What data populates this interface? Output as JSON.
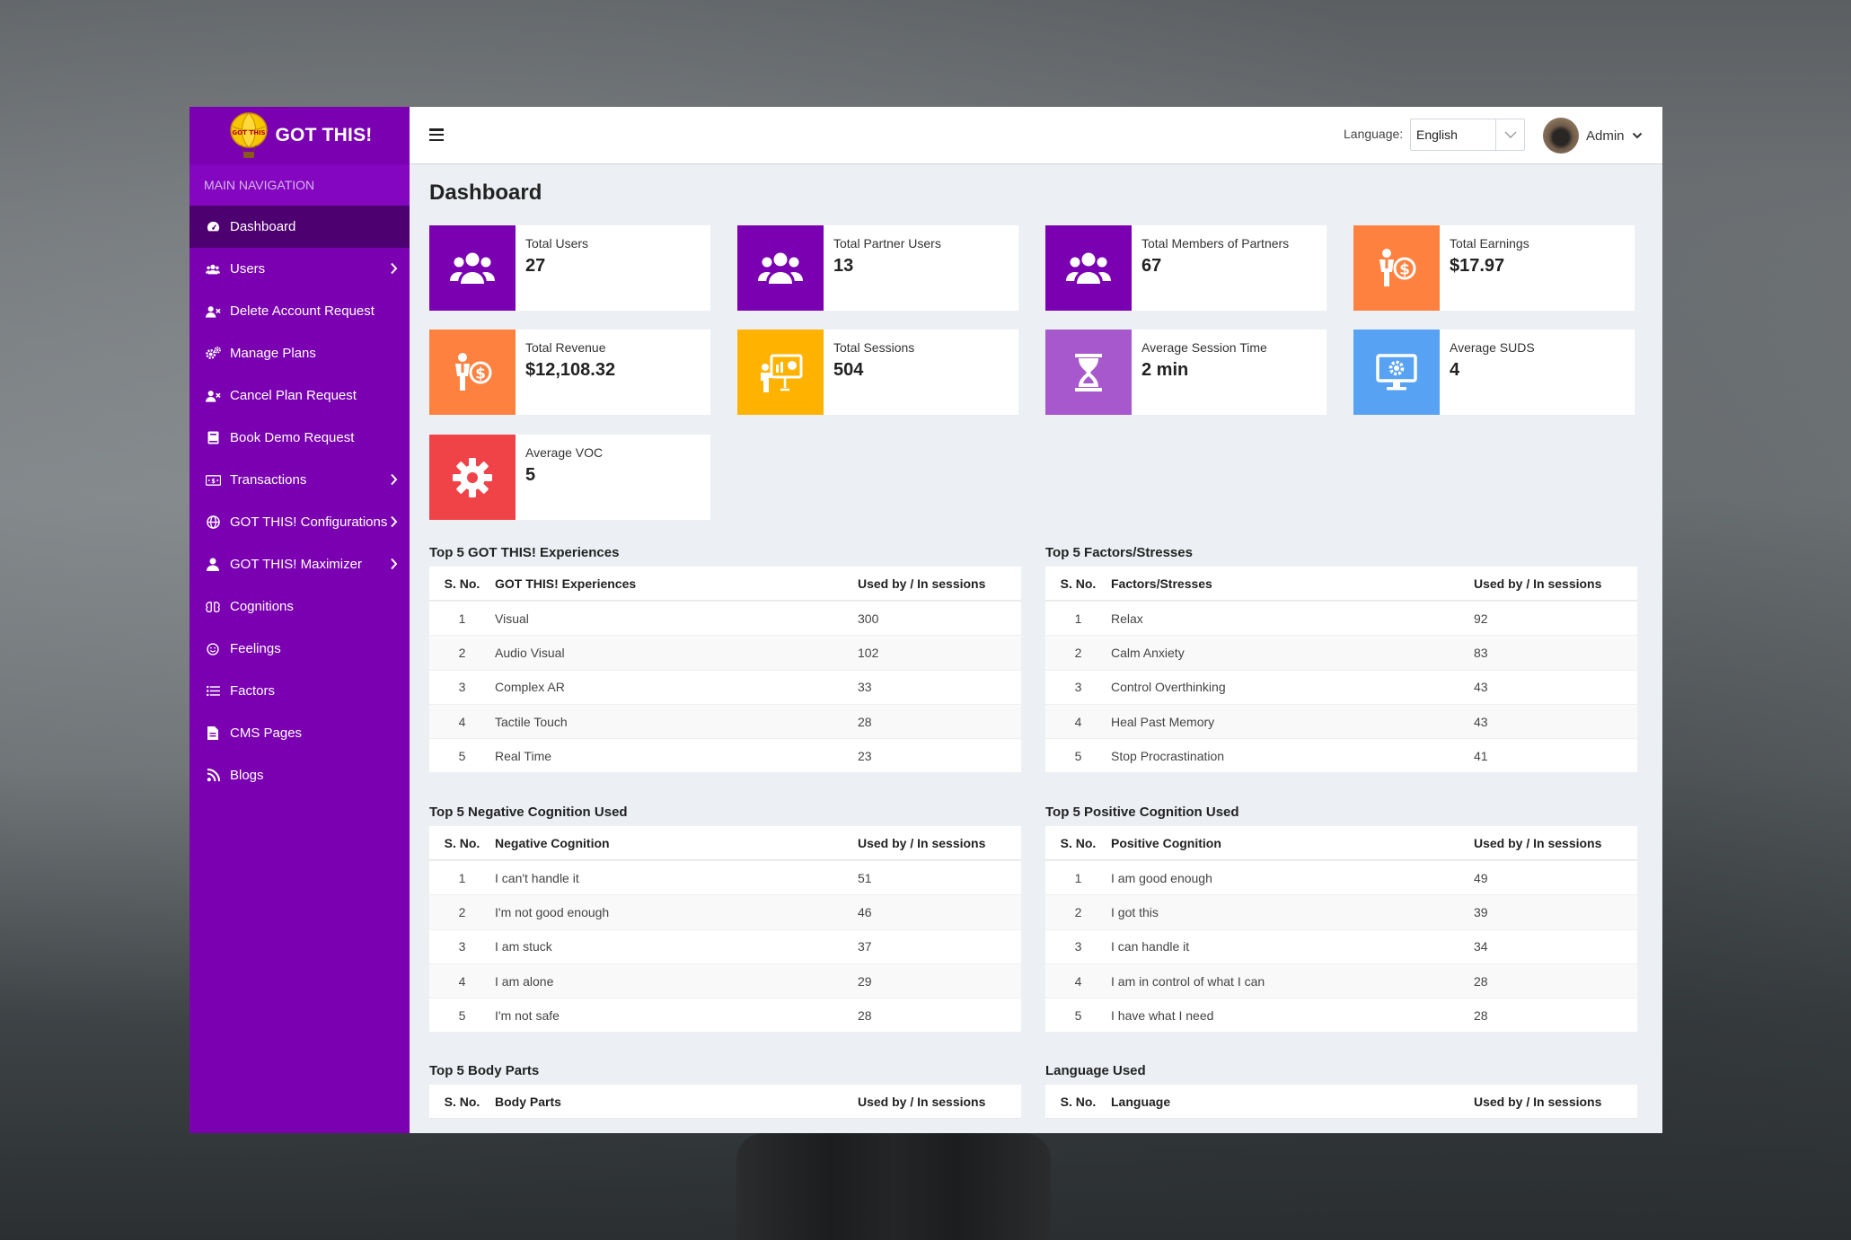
{
  "brand": {
    "name": "GOT THIS!"
  },
  "sidebar": {
    "header": "MAIN NAVIGATION",
    "items": [
      {
        "label": "Dashboard",
        "icon": "dashboard-icon",
        "active": true,
        "chevron": false
      },
      {
        "label": "Users",
        "icon": "users-icon",
        "active": false,
        "chevron": true
      },
      {
        "label": "Delete Account Request",
        "icon": "user-x-icon",
        "active": false,
        "chevron": false
      },
      {
        "label": "Manage Plans",
        "icon": "gears-icon",
        "active": false,
        "chevron": false
      },
      {
        "label": "Cancel Plan Request",
        "icon": "user-x-icon",
        "active": false,
        "chevron": false
      },
      {
        "label": "Book Demo Request",
        "icon": "book-icon",
        "active": false,
        "chevron": false
      },
      {
        "label": "Transactions",
        "icon": "money-icon",
        "active": false,
        "chevron": true
      },
      {
        "label": "GOT THIS! Configurations",
        "icon": "globe-icon",
        "active": false,
        "chevron": true
      },
      {
        "label": "GOT THIS! Maximizer",
        "icon": "user-icon",
        "active": false,
        "chevron": true
      },
      {
        "label": "Cognitions",
        "icon": "brain-icon",
        "active": false,
        "chevron": false
      },
      {
        "label": "Feelings",
        "icon": "smile-icon",
        "active": false,
        "chevron": false
      },
      {
        "label": "Factors",
        "icon": "list-icon",
        "active": false,
        "chevron": false
      },
      {
        "label": "CMS Pages",
        "icon": "file-icon",
        "active": false,
        "chevron": false
      },
      {
        "label": "Blogs",
        "icon": "blog-icon",
        "active": false,
        "chevron": false
      }
    ]
  },
  "header": {
    "language_label": "Language:",
    "language_value": "English",
    "user_name": "Admin"
  },
  "page": {
    "title": "Dashboard"
  },
  "colors": {
    "sidebar": "#7a00b2",
    "purple": "#7a00b2",
    "orange": "#ff8140",
    "yellow": "#ffb300",
    "lavender": "#a758cc",
    "blue": "#57a2f2",
    "red": "#f04348"
  },
  "stats": [
    {
      "label": "Total Users",
      "value": "27",
      "icon": "users-group-icon",
      "color": "#7a00b2"
    },
    {
      "label": "Total Partner Users",
      "value": "13",
      "icon": "users-group-icon",
      "color": "#7a00b2"
    },
    {
      "label": "Total Members of Partners",
      "value": "67",
      "icon": "users-group-icon",
      "color": "#7a00b2"
    },
    {
      "label": "Total Earnings",
      "value": "$17.97",
      "icon": "earnings-icon",
      "color": "#ff8140"
    },
    {
      "label": "Total Revenue",
      "value": "$12,108.32",
      "icon": "earnings-icon",
      "color": "#ff8140"
    },
    {
      "label": "Total Sessions",
      "value": "504",
      "icon": "presentation-icon",
      "color": "#ffb300"
    },
    {
      "label": "Average Session Time",
      "value": "2 min",
      "icon": "hourglass-icon",
      "color": "#a758cc"
    },
    {
      "label": "Average SUDS",
      "value": "4",
      "icon": "monitor-gear-icon",
      "color": "#57a2f2"
    },
    {
      "label": "Average VOC",
      "value": "5",
      "icon": "gear-icon",
      "color": "#f04348"
    }
  ],
  "tables": [
    {
      "title": "Top 5 GOT THIS! Experiences",
      "columns": [
        "S. No.",
        "GOT THIS! Experiences",
        "Used by / In sessions"
      ],
      "rows": [
        [
          "1",
          "Visual",
          "300"
        ],
        [
          "2",
          "Audio Visual",
          "102"
        ],
        [
          "3",
          "Complex AR",
          "33"
        ],
        [
          "4",
          "Tactile Touch",
          "28"
        ],
        [
          "5",
          "Real Time",
          "23"
        ]
      ]
    },
    {
      "title": "Top 5 Factors/Stresses",
      "columns": [
        "S. No.",
        "Factors/Stresses",
        "Used by / In sessions"
      ],
      "rows": [
        [
          "1",
          "Relax",
          "92"
        ],
        [
          "2",
          "Calm Anxiety",
          "83"
        ],
        [
          "3",
          "Control Overthinking",
          "43"
        ],
        [
          "4",
          "Heal Past Memory",
          "43"
        ],
        [
          "5",
          "Stop Procrastination",
          "41"
        ]
      ]
    },
    {
      "title": "Top 5 Negative Cognition Used",
      "columns": [
        "S. No.",
        "Negative Cognition",
        "Used by / In sessions"
      ],
      "rows": [
        [
          "1",
          "I can't handle it",
          "51"
        ],
        [
          "2",
          "I'm not good enough",
          "46"
        ],
        [
          "3",
          "I am stuck",
          "37"
        ],
        [
          "4",
          "I am alone",
          "29"
        ],
        [
          "5",
          "I'm not safe",
          "28"
        ]
      ]
    },
    {
      "title": "Top 5 Positive Cognition Used",
      "columns": [
        "S. No.",
        "Positive Cognition",
        "Used by / In sessions"
      ],
      "rows": [
        [
          "1",
          "I am good enough",
          "49"
        ],
        [
          "2",
          "I got this",
          "39"
        ],
        [
          "3",
          "I can handle it",
          "34"
        ],
        [
          "4",
          "I am in control of what I can",
          "28"
        ],
        [
          "5",
          "I have what I need",
          "28"
        ]
      ]
    },
    {
      "title": "Top 5 Body Parts",
      "columns": [
        "S. No.",
        "Body Parts",
        "Used by / In sessions"
      ],
      "rows": []
    },
    {
      "title": "Language Used",
      "columns": [
        "S. No.",
        "Language",
        "Used by / In sessions"
      ],
      "rows": []
    }
  ]
}
